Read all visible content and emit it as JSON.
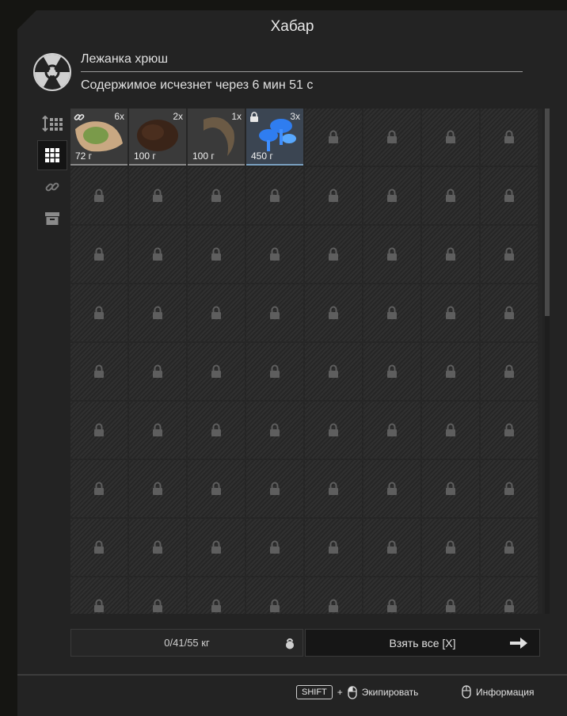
{
  "window": {
    "title": "Хабар"
  },
  "location": {
    "name": "Лежанка хрюш",
    "timer_text": "Содержимое исчезнет через 6 мин 51 с"
  },
  "side_tools": [
    {
      "name": "sort-icon",
      "active": false
    },
    {
      "name": "grid-view-icon",
      "active": true
    },
    {
      "name": "link-icon",
      "active": false
    },
    {
      "name": "archive-icon",
      "active": false
    }
  ],
  "items": [
    {
      "qty": "6x",
      "weight": "72 г",
      "icon": "chain-icon",
      "color": "#7a9a4a"
    },
    {
      "qty": "2x",
      "weight": "100 г",
      "icon": "",
      "color": "#3a2418"
    },
    {
      "qty": "1x",
      "weight": "100 г",
      "icon": "",
      "color": "#6b5a45"
    },
    {
      "qty": "3x",
      "weight": "450 г",
      "icon": "lock-icon",
      "color": "#2f7df0"
    }
  ],
  "grid": {
    "columns": 8,
    "locked_cells": 68
  },
  "footer": {
    "weight_text": "0/41/55 кг",
    "take_all_label": "Взять все [X]"
  },
  "hints": {
    "shift_key": "SHIFT",
    "plus": "+",
    "equip_label": "Экипировать",
    "info_label": "Информация"
  }
}
